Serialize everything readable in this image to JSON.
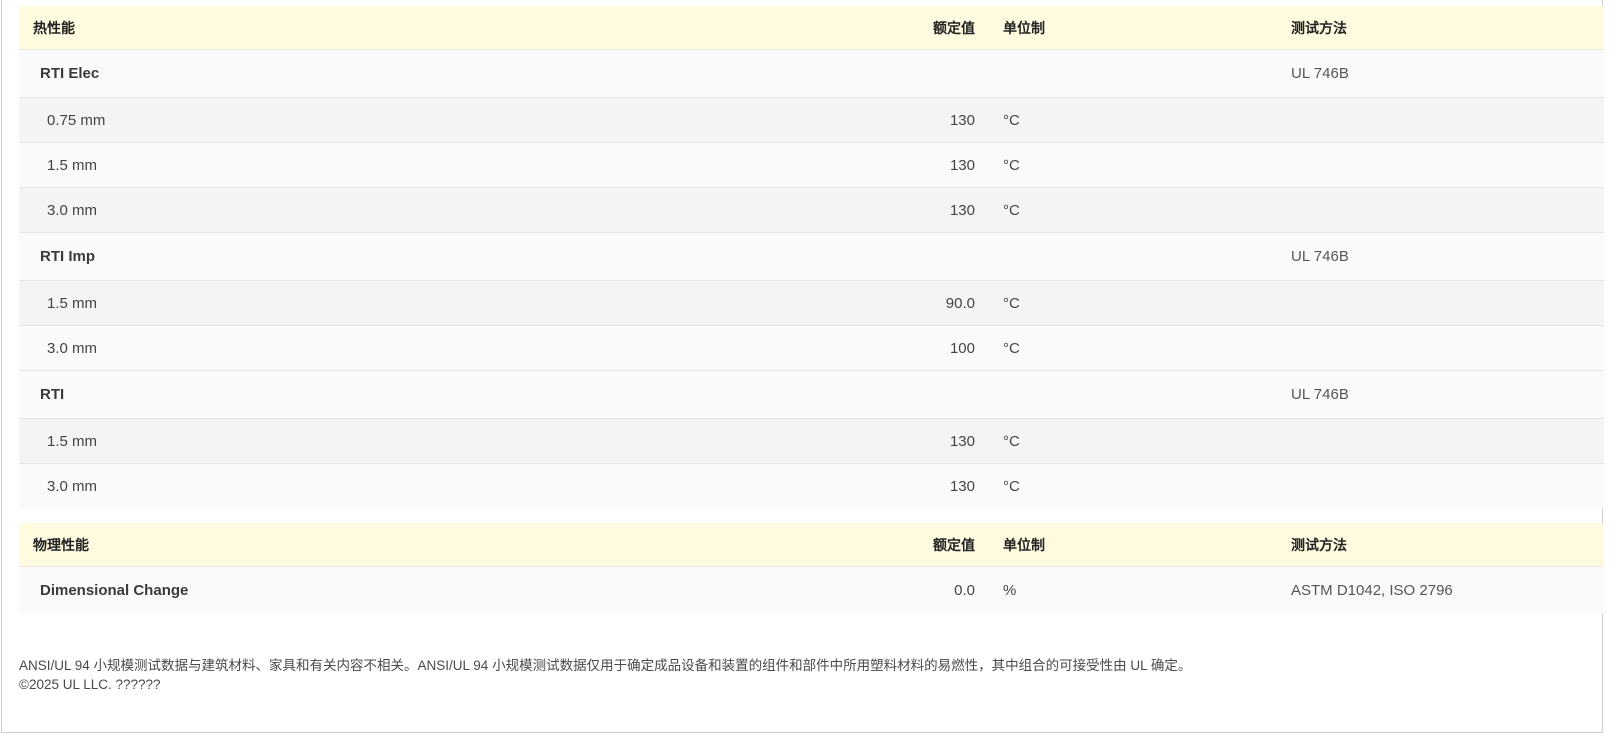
{
  "thermal": {
    "header": {
      "name": "热性能",
      "value": "额定值",
      "unit": "单位制",
      "method": "测试方法"
    },
    "rows": [
      {
        "type": "group",
        "name": "RTI Elec",
        "value": "",
        "unit": "",
        "method": "UL 746B"
      },
      {
        "type": "sub",
        "name": "0.75 mm",
        "value": "130",
        "unit": "°C",
        "method": ""
      },
      {
        "type": "sub",
        "name": "1.5 mm",
        "value": "130",
        "unit": "°C",
        "method": ""
      },
      {
        "type": "sub",
        "name": "3.0 mm",
        "value": "130",
        "unit": "°C",
        "method": ""
      },
      {
        "type": "group",
        "name": "RTI Imp",
        "value": "",
        "unit": "",
        "method": "UL 746B"
      },
      {
        "type": "sub",
        "name": "1.5 mm",
        "value": "90.0",
        "unit": "°C",
        "method": ""
      },
      {
        "type": "sub",
        "name": "3.0 mm",
        "value": "100",
        "unit": "°C",
        "method": ""
      },
      {
        "type": "group",
        "name": "RTI",
        "value": "",
        "unit": "",
        "method": "UL 746B"
      },
      {
        "type": "sub",
        "name": "1.5 mm",
        "value": "130",
        "unit": "°C",
        "method": ""
      },
      {
        "type": "sub",
        "name": "3.0 mm",
        "value": "130",
        "unit": "°C",
        "method": ""
      }
    ]
  },
  "physical": {
    "header": {
      "name": "物理性能",
      "value": "额定值",
      "unit": "单位制",
      "method": "测试方法"
    },
    "rows": [
      {
        "type": "group",
        "name": "Dimensional Change",
        "value": "0.0",
        "unit": "%",
        "method": "ASTM D1042, ISO 2796"
      }
    ]
  },
  "footer": {
    "disclaimer": "ANSI/UL 94 小规模测试数据与建筑材料、家具和有关内容不相关。ANSI/UL 94 小规模测试数据仅用于确定成品设备和装置的组件和部件中所用塑料材料的易燃性，其中组合的可接受性由 UL 确定。",
    "copyright": "©2025 UL LLC. ??????"
  }
}
